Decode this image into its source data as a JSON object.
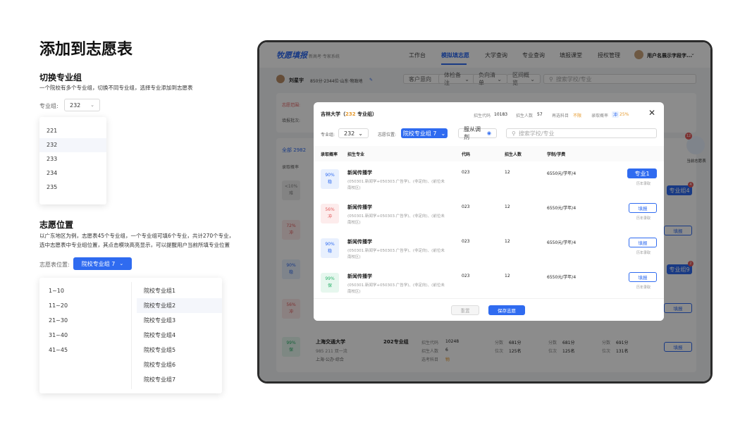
{
  "doc": {
    "title": "添加到志愿表",
    "section1": {
      "heading": "切换专业组",
      "desc": "一个院校有多个专业组，切换不同专业组，选择专业添加到志愿表",
      "label": "专业组:",
      "value": "232",
      "options": [
        "221",
        "232",
        "233",
        "234",
        "235"
      ]
    },
    "section2": {
      "heading": "志愿位置",
      "desc1": "以广东地区为例，志愿表45个专业组，一个专业组可填6个专业，共计270个专业，",
      "desc2": "选中志愿表中专业组位置，其点击模块高亮显示，可以提醒用户当前所填专业位置",
      "label": "志愿表位置:",
      "button": "院校专业组 7",
      "ranges": [
        "1~10",
        "11~20",
        "21~30",
        "31~40",
        "41~45"
      ],
      "groups": [
        "院校专业组1",
        "院校专业组2",
        "院校专业组3",
        "院校专业组4",
        "院校专业组5",
        "院校专业组6",
        "院校专业组7"
      ]
    }
  },
  "app": {
    "logo": "牧愿填报",
    "logo_sub": "新高考·专家系统",
    "nav": [
      "工作台",
      "模拟填志愿",
      "大学查询",
      "专业查询",
      "填报课堂",
      "授权管理"
    ],
    "user": "用户名展示字段字...",
    "student": {
      "name": "刘星宇",
      "info": "850分·2344位·山东·物政地"
    },
    "filters": [
      "客户意向",
      "体检备注",
      "负向清单",
      "区间概览"
    ],
    "search_placeholder": "搜索学校/专业",
    "side_label": "当前志愿表",
    "side_badge": "12",
    "bg": {
      "range_label": "志愿范围:",
      "batch_label": "填报批次:",
      "all_label": "全部",
      "all_count": "2982",
      "col_prob": "录取概率"
    },
    "bg_pills": [
      {
        "p": "<10%",
        "t": "难"
      },
      {
        "p": "72%",
        "t": "冲"
      },
      {
        "p": "90%",
        "t": "稳"
      },
      {
        "p": "56%",
        "t": "冲"
      },
      {
        "p": "99%",
        "t": "保"
      }
    ],
    "bg_btns": [
      "专业组4",
      "填报",
      "专业组9",
      "填报"
    ],
    "bg_badges": [
      "4",
      "2"
    ],
    "bottom": {
      "school": "上海交通大学",
      "group": "202专业组",
      "tags": [
        "985",
        "211",
        "双一流"
      ],
      "loc": "上海·公办·综合",
      "code_label": "招生代码",
      "code": "10248",
      "count_label": "招生人数",
      "count": "6",
      "subj_label": "选考科目",
      "subj": "物",
      "s1l": "分数",
      "s1": "681分",
      "r1l": "位次",
      "r1": "125名",
      "s2l": "分数",
      "s2": "681分",
      "r2l": "位次",
      "r2": "125名",
      "s3l": "分数",
      "s3": "691分",
      "r3l": "位次",
      "r3": "131名",
      "btn": "填报"
    },
    "modal": {
      "school": "吉林大学",
      "group_pre": "（",
      "group_num": "232",
      "group_post": " 专业组）",
      "code_label": "招生代码",
      "code": "10183",
      "count_label": "招生人数",
      "count": "57",
      "subj_label": "再选科目",
      "subj": "不限",
      "prob_label": "录取概率",
      "prob_tag": "冲",
      "prob": "25%",
      "group_label": "专业组:",
      "group_val": "232",
      "pos_label": "志愿位置:",
      "pos_btn": "院校专业组 7",
      "adjust": "服从调剂",
      "search_ph": "搜索学校/专业",
      "headers": [
        "录取概率",
        "招生专业",
        "代码",
        "招生人数",
        "学制/学费"
      ],
      "rows": [
        {
          "p": "90%",
          "t": "稳",
          "name": "新闻传播学",
          "d1": "(050301.新闻学+050303.广告学)、(非定向)、(前位未",
          "d2": "南校区)",
          "code": "023",
          "num": "12",
          "fee": "6550元/学年/4",
          "btn": "专业1",
          "hist": "历年录取"
        },
        {
          "p": "56%",
          "t": "冲",
          "name": "新闻传播学",
          "d1": "(050301.新闻学+050303.广告学)、(非定向)、(前位未",
          "d2": "南校区)",
          "code": "023",
          "num": "12",
          "fee": "6550元/学年/4",
          "btn": "填报",
          "hist": "历年录取"
        },
        {
          "p": "90%",
          "t": "稳",
          "name": "新闻传播学",
          "d1": "(050301.新闻学+050303.广告学)、(非定向)、(前位未",
          "d2": "南校区)",
          "code": "023",
          "num": "12",
          "fee": "6550元/学年/4",
          "btn": "填报",
          "hist": "历年录取"
        },
        {
          "p": "99%",
          "t": "保",
          "name": "新闻传播学",
          "d1": "(050301.新闻学+050303.广告学)、(非定向)、(前位未",
          "d2": "南校区)",
          "code": "023",
          "num": "12",
          "fee": "6550元/学年/4",
          "btn": "填报",
          "hist": "历年录取"
        }
      ],
      "reset": "重置",
      "save": "保存志愿"
    }
  },
  "colors": {
    "accent": "#2f6bf0",
    "stable_bg": "#e8f0fe",
    "rush_bg": "#fdecec",
    "rush": "#e25b5b",
    "safe_bg": "#e6f7ee",
    "safe": "#2bb36b"
  }
}
